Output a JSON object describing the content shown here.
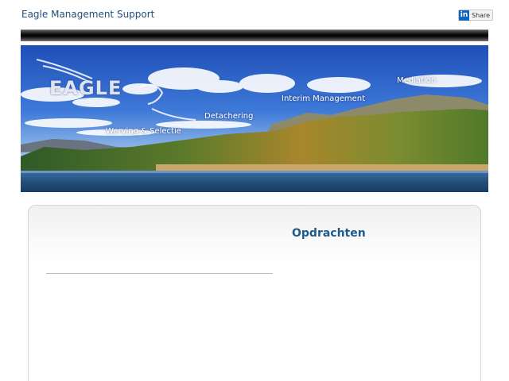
{
  "header": {
    "site_title": "Eagle Management Support",
    "share": {
      "label": "Share",
      "icon": "linkedin-icon",
      "icon_text": "in"
    }
  },
  "banner": {
    "logo_text": "EAGLE",
    "links": {
      "werving": "Werving & Selectie",
      "detachering": "Detachering",
      "interim": "Interim Management",
      "mediation": "Mediation"
    }
  },
  "main": {
    "section_title": "Opdrachten"
  },
  "colors": {
    "title_blue": "#1f4e79",
    "heading_blue": "#1f5a8c",
    "linkedin_blue": "#0a66c2"
  }
}
